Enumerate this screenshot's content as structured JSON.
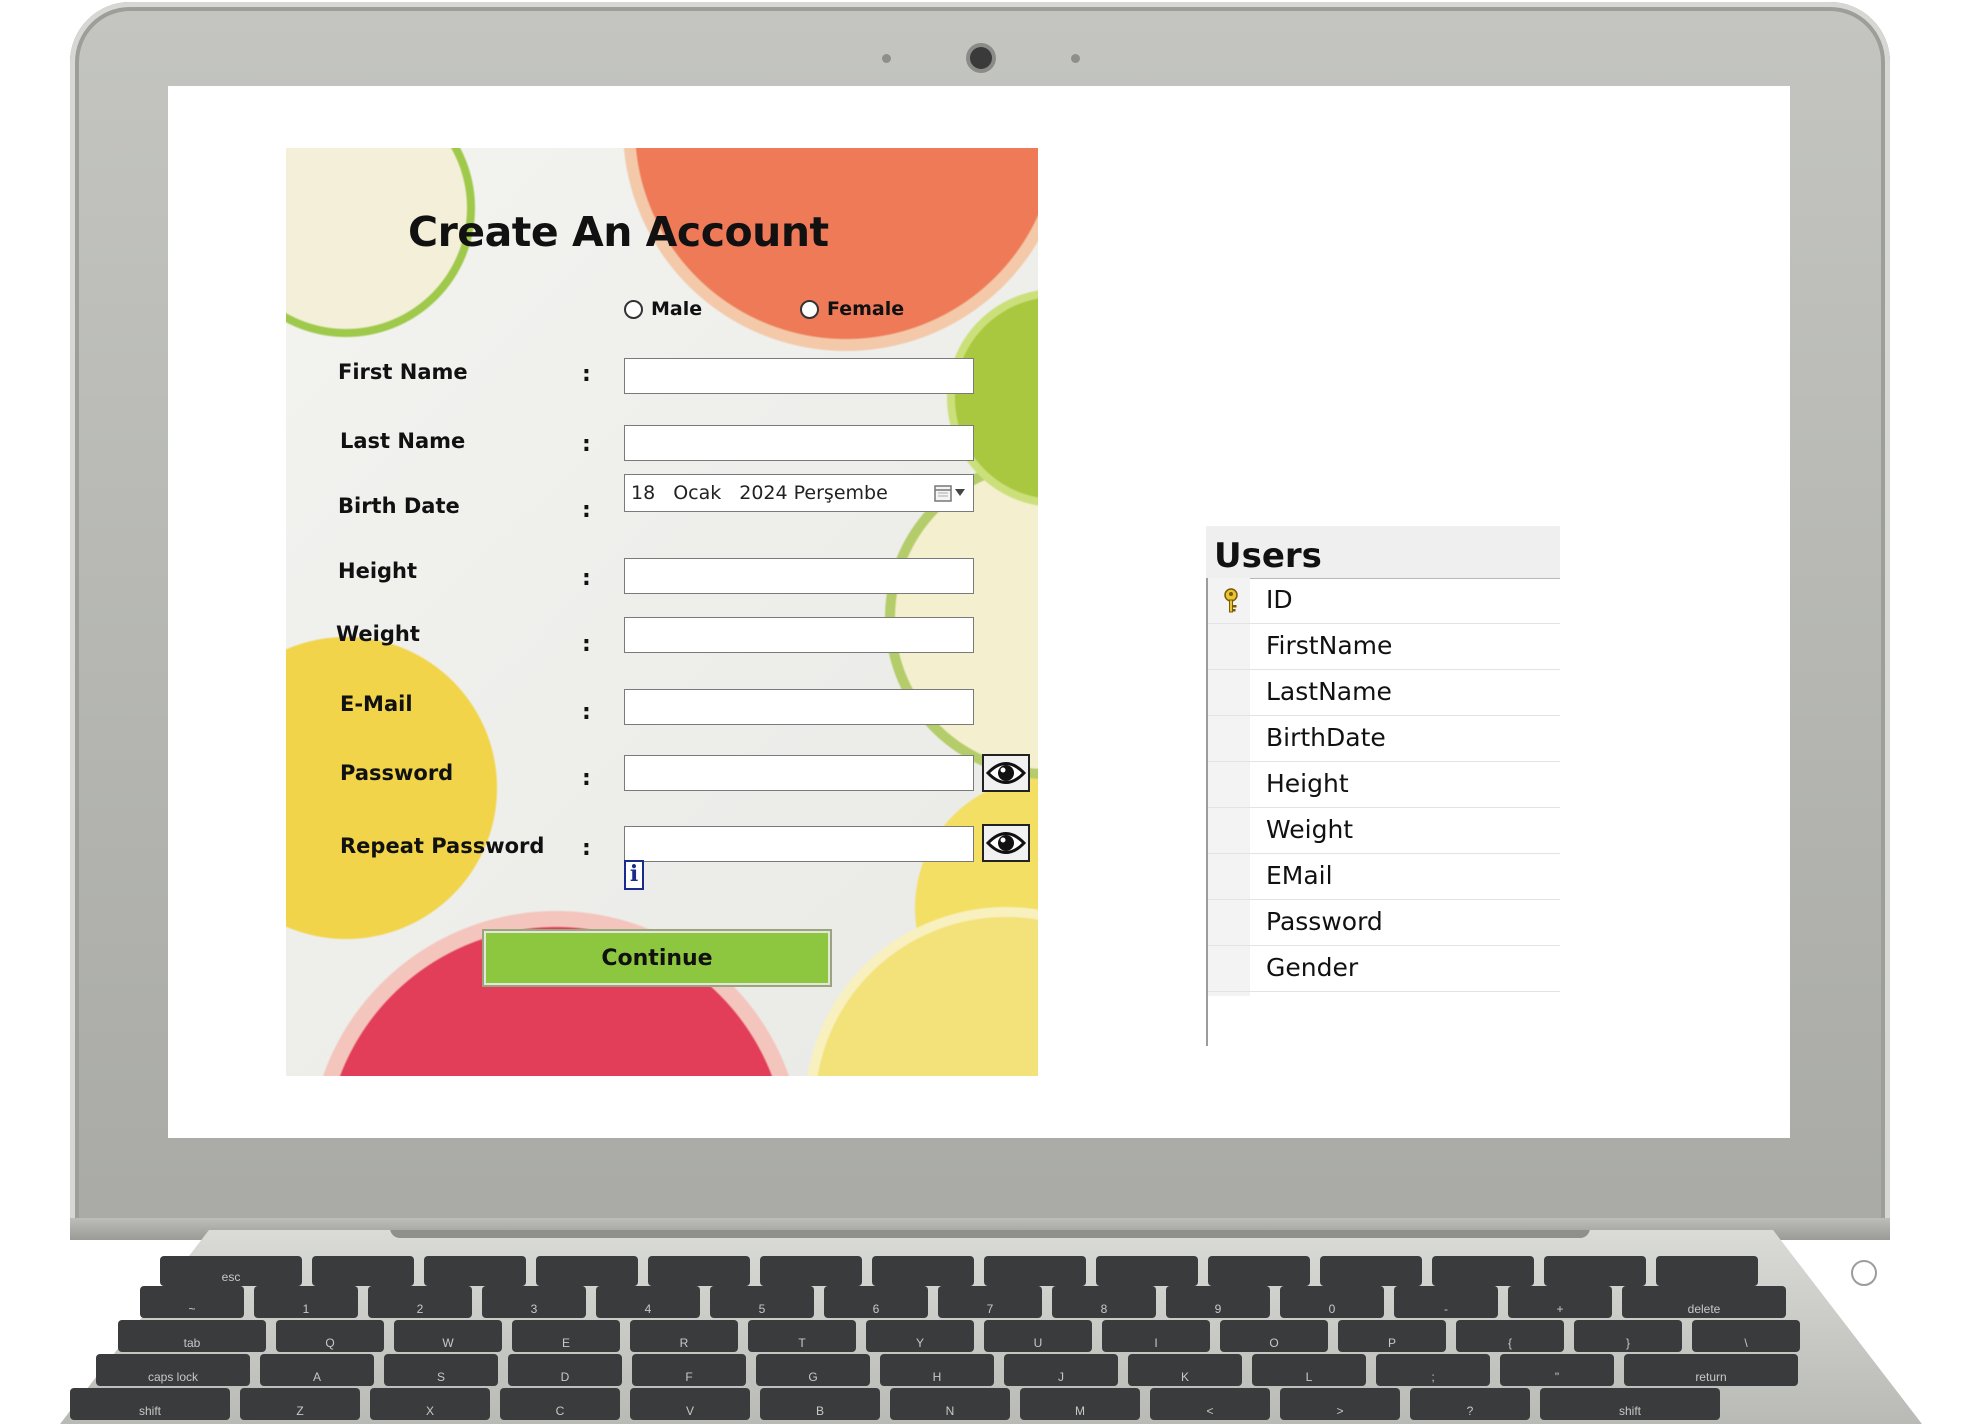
{
  "form": {
    "title": "Create An Account",
    "gender": {
      "male": "Male",
      "female": "Female"
    },
    "labels": {
      "first_name": "First Name",
      "last_name": "Last Name",
      "birth_date": "Birth Date",
      "height": "Height",
      "weight": "Weight",
      "email": "E-Mail",
      "password": "Password",
      "repeat_password": "Repeat Password"
    },
    "colon": ":",
    "values": {
      "first_name": "",
      "last_name": "",
      "height": "",
      "weight": "",
      "email": "",
      "password": "",
      "repeat_password": ""
    },
    "birth_date": {
      "day": "18",
      "month": "Ocak",
      "year_weekday": "2024 Perşembe"
    },
    "info_icon": "i",
    "continue_label": "Continue"
  },
  "users_table": {
    "title": "Users",
    "columns": [
      "ID",
      "FirstName",
      "LastName",
      "BirthDate",
      "Height",
      "Weight",
      "EMail",
      "Password",
      "Gender"
    ],
    "primary_key": "ID"
  },
  "keyboard": {
    "row1": [
      "esc",
      "",
      "",
      "",
      "",
      "",
      "",
      "",
      "",
      "",
      "",
      "",
      "",
      ""
    ],
    "row2": [
      "~",
      "1",
      "2",
      "3",
      "4",
      "5",
      "6",
      "7",
      "8",
      "9",
      "0",
      "-",
      "+",
      "delete"
    ],
    "row3": [
      "tab",
      "Q",
      "W",
      "E",
      "R",
      "T",
      "Y",
      "U",
      "I",
      "O",
      "P",
      "{",
      "}",
      "\\"
    ],
    "row4": [
      "caps lock",
      "A",
      "S",
      "D",
      "F",
      "G",
      "H",
      "J",
      "K",
      "L",
      ";",
      "\"",
      "return"
    ],
    "row5": [
      "shift",
      "Z",
      "X",
      "C",
      "V",
      "B",
      "N",
      "M",
      "<",
      ">",
      "?",
      "shift"
    ]
  },
  "colors": {
    "continue_button": "#8dc63f",
    "keyboard_key": "#3a3b3d",
    "laptop_body": "#b1b2ae"
  }
}
